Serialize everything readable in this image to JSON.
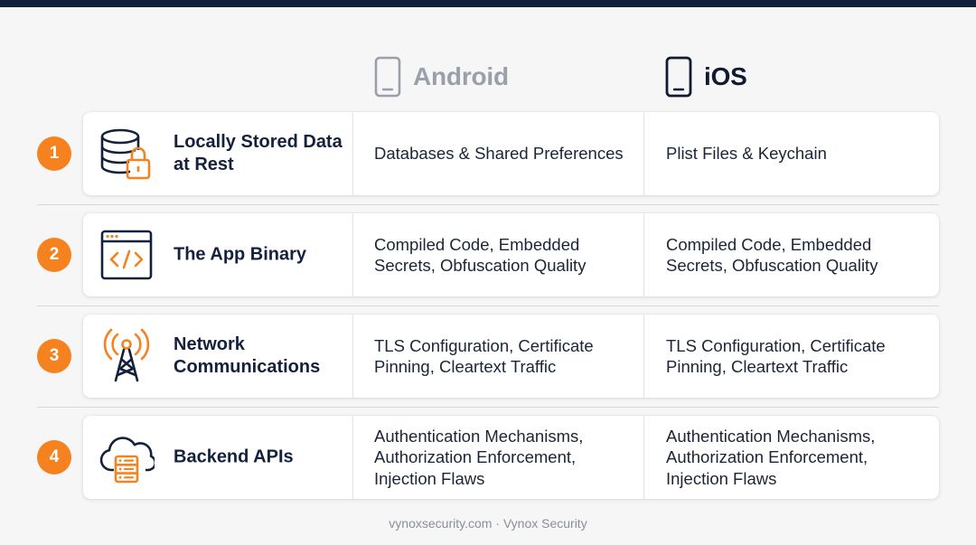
{
  "columns": {
    "android": {
      "label": "Android",
      "icon": "smartphone-icon",
      "color": "#9aa0aa"
    },
    "ios": {
      "label": "iOS",
      "icon": "smartphone-icon",
      "color": "#101a30"
    }
  },
  "accent_color": "#f5821f",
  "rows": [
    {
      "number": "1",
      "title": "Locally Stored Data at Rest",
      "icon": "database-lock-icon",
      "android": "Databases & Shared Preferences",
      "ios": "Plist Files & Keychain"
    },
    {
      "number": "2",
      "title": "The App Binary",
      "icon": "code-window-icon",
      "android": "Compiled Code, Embedded Secrets, Obfuscation Quality",
      "ios": "Compiled Code, Embedded Secrets, Obfuscation Quality"
    },
    {
      "number": "3",
      "title": "Network Communications",
      "icon": "broadcast-tower-icon",
      "android": "TLS Configuration, Certificate Pinning, Cleartext Traffic",
      "ios": "TLS Configuration, Certificate Pinning, Cleartext Traffic"
    },
    {
      "number": "4",
      "title": "Backend APIs",
      "icon": "cloud-server-icon",
      "android": "Authentication Mechanisms, Authorization Enforcement, Injection Flaws",
      "ios": "Authentication Mechanisms, Authorization Enforcement, Injection Flaws"
    }
  ],
  "footer": "vynoxsecurity.com · Vynox Security"
}
